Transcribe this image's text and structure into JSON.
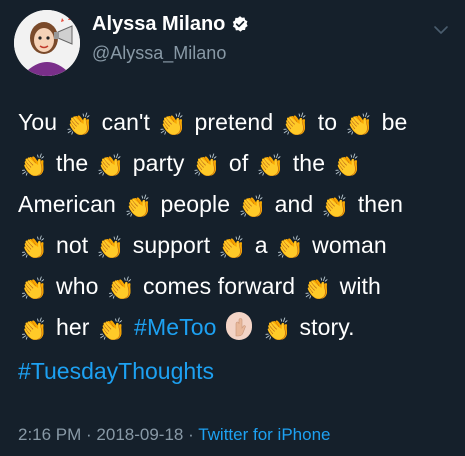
{
  "user": {
    "display_name": "Alyssa Milano",
    "handle": "@Alyssa_Milano",
    "verified": true,
    "avatar_icon": "avatar-illustration-icon"
  },
  "tweet": {
    "lines": [
      [
        "You",
        "clap",
        "can't",
        "clap",
        "pretend",
        "clap",
        "to",
        "clap",
        "be"
      ],
      [
        "clap",
        "the",
        "clap",
        "party",
        "clap",
        "of",
        "clap",
        "the",
        "clap"
      ],
      [
        "American",
        "clap",
        "people",
        "clap",
        "and",
        "clap",
        "then"
      ],
      [
        "clap",
        "not",
        "clap",
        "support",
        "clap",
        "a",
        "clap",
        "woman"
      ],
      [
        "clap",
        "who",
        "clap",
        "comes forward",
        "clap",
        "with"
      ],
      [
        "clap",
        "her",
        "clap",
        "#MeToo",
        "hand",
        "clap",
        "story."
      ]
    ],
    "hashtag_tuesday": "#TuesdayThoughts"
  },
  "footer": {
    "time": "2:16 PM",
    "separator1": " · ",
    "date": "2018-09-18",
    "separator2": " · ",
    "source": "Twitter for iPhone"
  },
  "colors": {
    "background": "#15202b",
    "link": "#1da1f2",
    "secondary": "#8899a6"
  }
}
